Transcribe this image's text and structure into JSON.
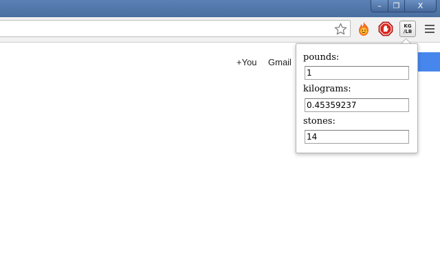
{
  "window": {
    "minimize_glyph": "–",
    "maximize_glyph": "❐",
    "close_glyph": "X"
  },
  "toolbar": {
    "omnibox_value": "",
    "star_icon": "star-outline",
    "extensions": [
      {
        "name": "hola-fire-icon"
      },
      {
        "name": "adblock-stop-icon"
      },
      {
        "name": "kg-lb-converter",
        "label_line1": "KG",
        "label_line2": "/LB"
      }
    ],
    "menu_icon": "hamburger-menu"
  },
  "google_bar": {
    "you_link": "+You",
    "gmail_link": "Gmail"
  },
  "converter": {
    "fields": [
      {
        "label": "pounds:",
        "value": "1"
      },
      {
        "label": "kilograms:",
        "value": "0.45359237"
      },
      {
        "label": "stones:",
        "value": "14"
      }
    ]
  },
  "colors": {
    "titlebar": "#4a6fa0",
    "sign_in_button": "#4787ed"
  }
}
